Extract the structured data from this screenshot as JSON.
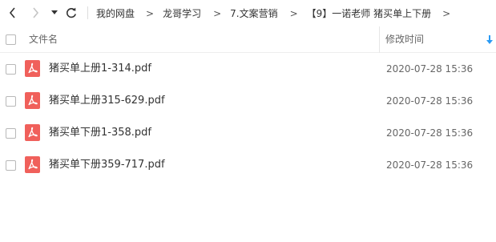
{
  "toolbar": {
    "back_icon": "chevron-left-icon",
    "forward_icon": "chevron-right-icon",
    "history_icon": "caret-down-icon",
    "refresh_icon": "refresh-icon",
    "breadcrumb": [
      "我的网盘",
      "龙哥学习",
      "7.文案营销",
      "【9】一诺老师 猪买单上下册"
    ],
    "separator": ">"
  },
  "columns": {
    "name": "文件名",
    "modified": "修改时间",
    "sort_icon": "sort-descending-arrow-icon",
    "sort_color": "#2b9bf4"
  },
  "files": [
    {
      "name": "猪买单上册1-314.pdf",
      "modified": "2020-07-28 15:36",
      "icon": "pdf-icon"
    },
    {
      "name": "猪买单上册315-629.pdf",
      "modified": "2020-07-28 15:36",
      "icon": "pdf-icon"
    },
    {
      "name": "猪买单下册1-358.pdf",
      "modified": "2020-07-28 15:36",
      "icon": "pdf-icon"
    },
    {
      "name": "猪买单下册359-717.pdf",
      "modified": "2020-07-28 15:36",
      "icon": "pdf-icon"
    }
  ],
  "colors": {
    "pdf_icon": "#f0605b",
    "text": "#333333",
    "muted_text": "#666666"
  }
}
